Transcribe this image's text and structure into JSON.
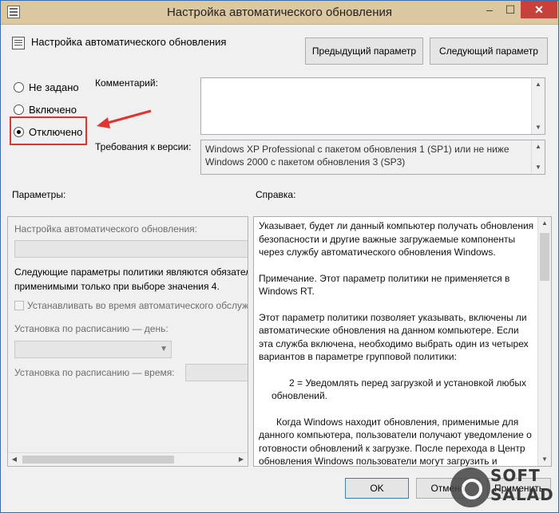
{
  "window": {
    "title": "Настройка автоматического обновления",
    "controls": {
      "minimize": "–",
      "maximize": "☐",
      "close": "✕"
    }
  },
  "header": {
    "policy_name": "Настройка автоматического обновления",
    "prev_button": "Предыдущий параметр",
    "next_button": "Следующий параметр"
  },
  "state": {
    "options": [
      {
        "label": "Не задано",
        "selected": false
      },
      {
        "label": "Включено",
        "selected": false
      },
      {
        "label": "Отключено",
        "selected": true
      }
    ]
  },
  "comment": {
    "label": "Комментарий:",
    "value": ""
  },
  "supported": {
    "label": "Требования к версии:",
    "lines": [
      "Windows XP Professional с пакетом обновления 1 (SP1) или не ниже",
      "Windows 2000 с пакетом обновления 3 (SP3)"
    ]
  },
  "options_section": {
    "label": "Параметры:",
    "config_label": "Настройка автоматического обновления:",
    "note_line1": "Следующие параметры политики являются обязател",
    "note_line2": "применимыми только при выборе значения 4.",
    "checkbox_label": "Устанавливать во время автоматического обслуж",
    "day_label": "Установка по расписанию — день:",
    "time_label": "Установка по расписанию — время:"
  },
  "help_section": {
    "label": "Справка:",
    "paragraphs": [
      "Указывает, будет ли данный компьютер получать обновления безопасности и другие важные загружаемые компоненты через службу автоматического обновления Windows.",
      "Примечание. Этот параметр политики не применяется в Windows RT.",
      "Этот параметр политики позволяет указывать, включены ли автоматические обновления на данном компьютере. Если эта служба включена, необходимо выбрать один из четырех вариантов в параметре групповой политики:",
      "2 = Уведомлять перед загрузкой и установкой любых обновлений.",
      "Когда Windows находит обновления, применимые для данного компьютера, пользователи получают уведомление о готовности обновлений к загрузке. После перехода в Центр обновления Windows пользователи могут загрузить и"
    ]
  },
  "footer": {
    "ok": "OK",
    "cancel": "Отмена",
    "apply": "Применить"
  },
  "watermark": {
    "line1": "SOFT",
    "line2": "SALAD"
  },
  "colors": {
    "titlebar": "#dcc8a0",
    "close": "#c7413c",
    "highlight": "#e03434"
  }
}
